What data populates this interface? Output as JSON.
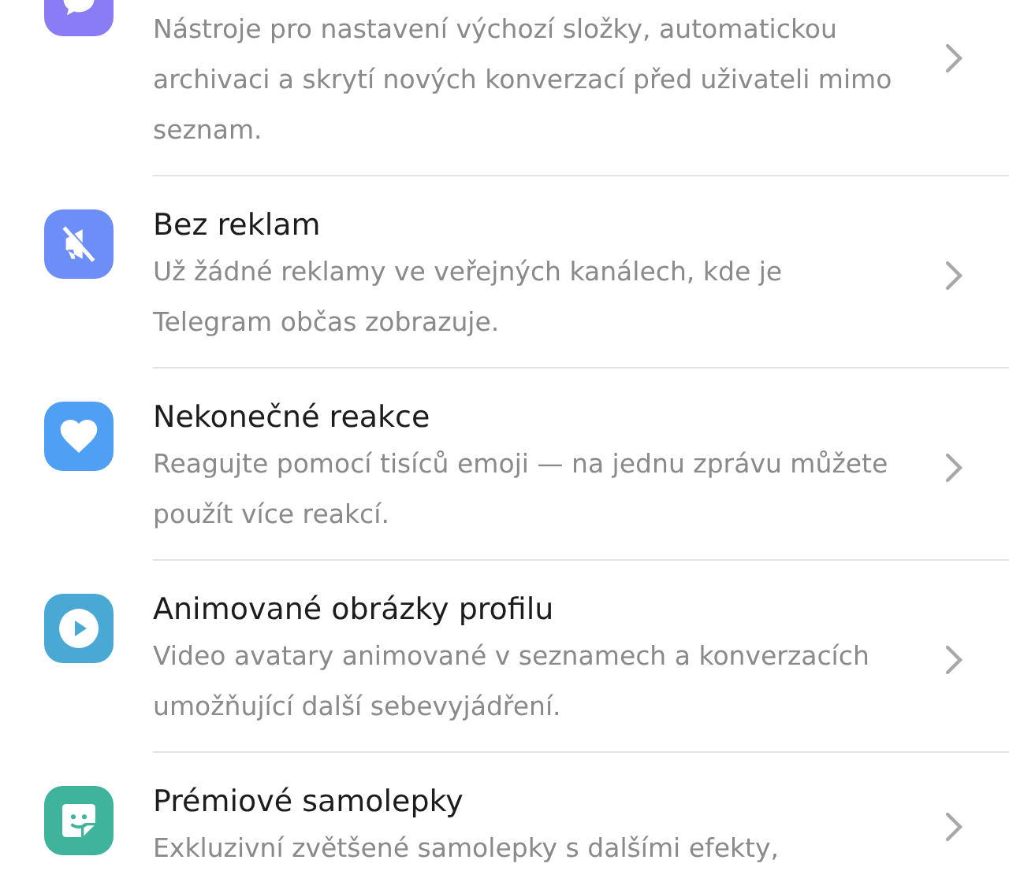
{
  "features": [
    {
      "kind": "chat",
      "color": "#8a7cf5",
      "description": "Nástroje pro nastavení výchozí složky, automatickou archivaci a skrytí nových konverzací před uživateli mimo seznam."
    },
    {
      "kind": "no-ads",
      "color": "#6e8ef7",
      "title": "Bez reklam",
      "description": "Už žádné reklamy ve veřejných kanálech, kde je Telegram občas zobrazuje."
    },
    {
      "kind": "heart",
      "color": "#4f9ff4",
      "title": "Nekonečné reakce",
      "description": "Reagujte pomocí tisíců emoji — na jednu zprávu můžete použít více reakcí."
    },
    {
      "kind": "play",
      "color": "#4aa8d5",
      "title": "Animované obrázky profilu",
      "description": "Video avatary animované v seznamech a konverzacích umožňující další sebevyjádření."
    },
    {
      "kind": "sticker",
      "color": "#3fb39b",
      "title": "Prémiové samolepky",
      "description": "Exkluzivní zvětšené samolepky s dalšími efekty,"
    }
  ]
}
